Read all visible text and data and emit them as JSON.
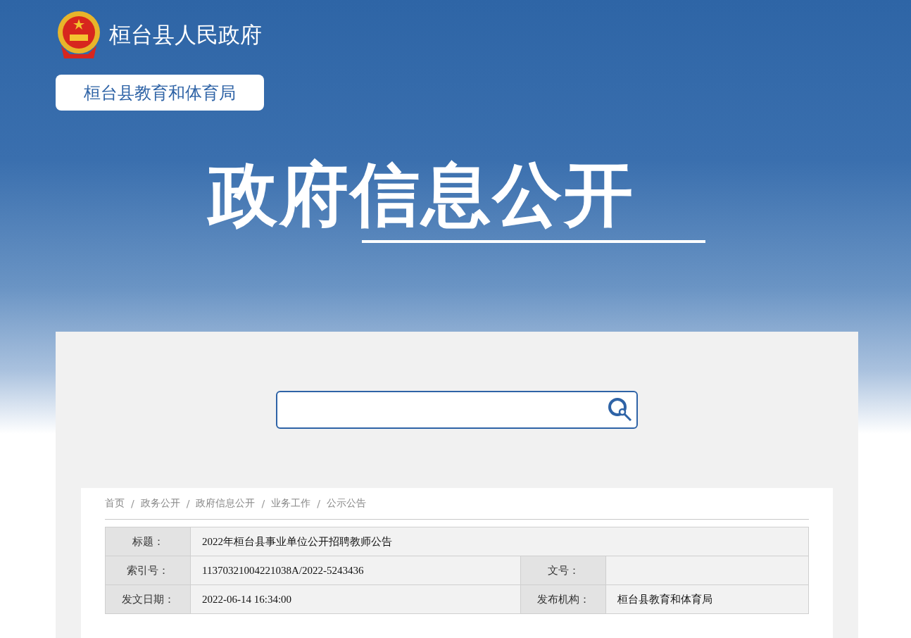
{
  "site": {
    "title": "桓台县人民政府",
    "department": "桓台县教育和体育局"
  },
  "hero": {
    "title": "政府信息公开"
  },
  "breadcrumb": [
    {
      "kind": "link",
      "text": "首页"
    },
    {
      "kind": "separator",
      "text": "/"
    },
    {
      "kind": "link",
      "text": "政务公开"
    },
    {
      "kind": "separator",
      "text": "/"
    },
    {
      "kind": "link",
      "text": "政府信息公开"
    },
    {
      "kind": "separator",
      "text": "/"
    },
    {
      "kind": "link",
      "text": "业务工作"
    },
    {
      "kind": "separator",
      "text": "/"
    },
    {
      "kind": "link",
      "text": "公示公告"
    }
  ],
  "info_rows": [
    [
      {
        "label": "标题：",
        "value": "2022年桓台县事业单位公开招聘教师公告"
      }
    ],
    [
      {
        "label": "索引号：",
        "value": "11370321004221038A/2022-5243436"
      },
      {
        "label": "文号："
      }
    ],
    [
      {
        "label": "发文日期：",
        "value": "2022-06-14 16:34:00"
      },
      {
        "label": "发布机构：",
        "value": "桓台县教育和体育局"
      }
    ]
  ]
}
